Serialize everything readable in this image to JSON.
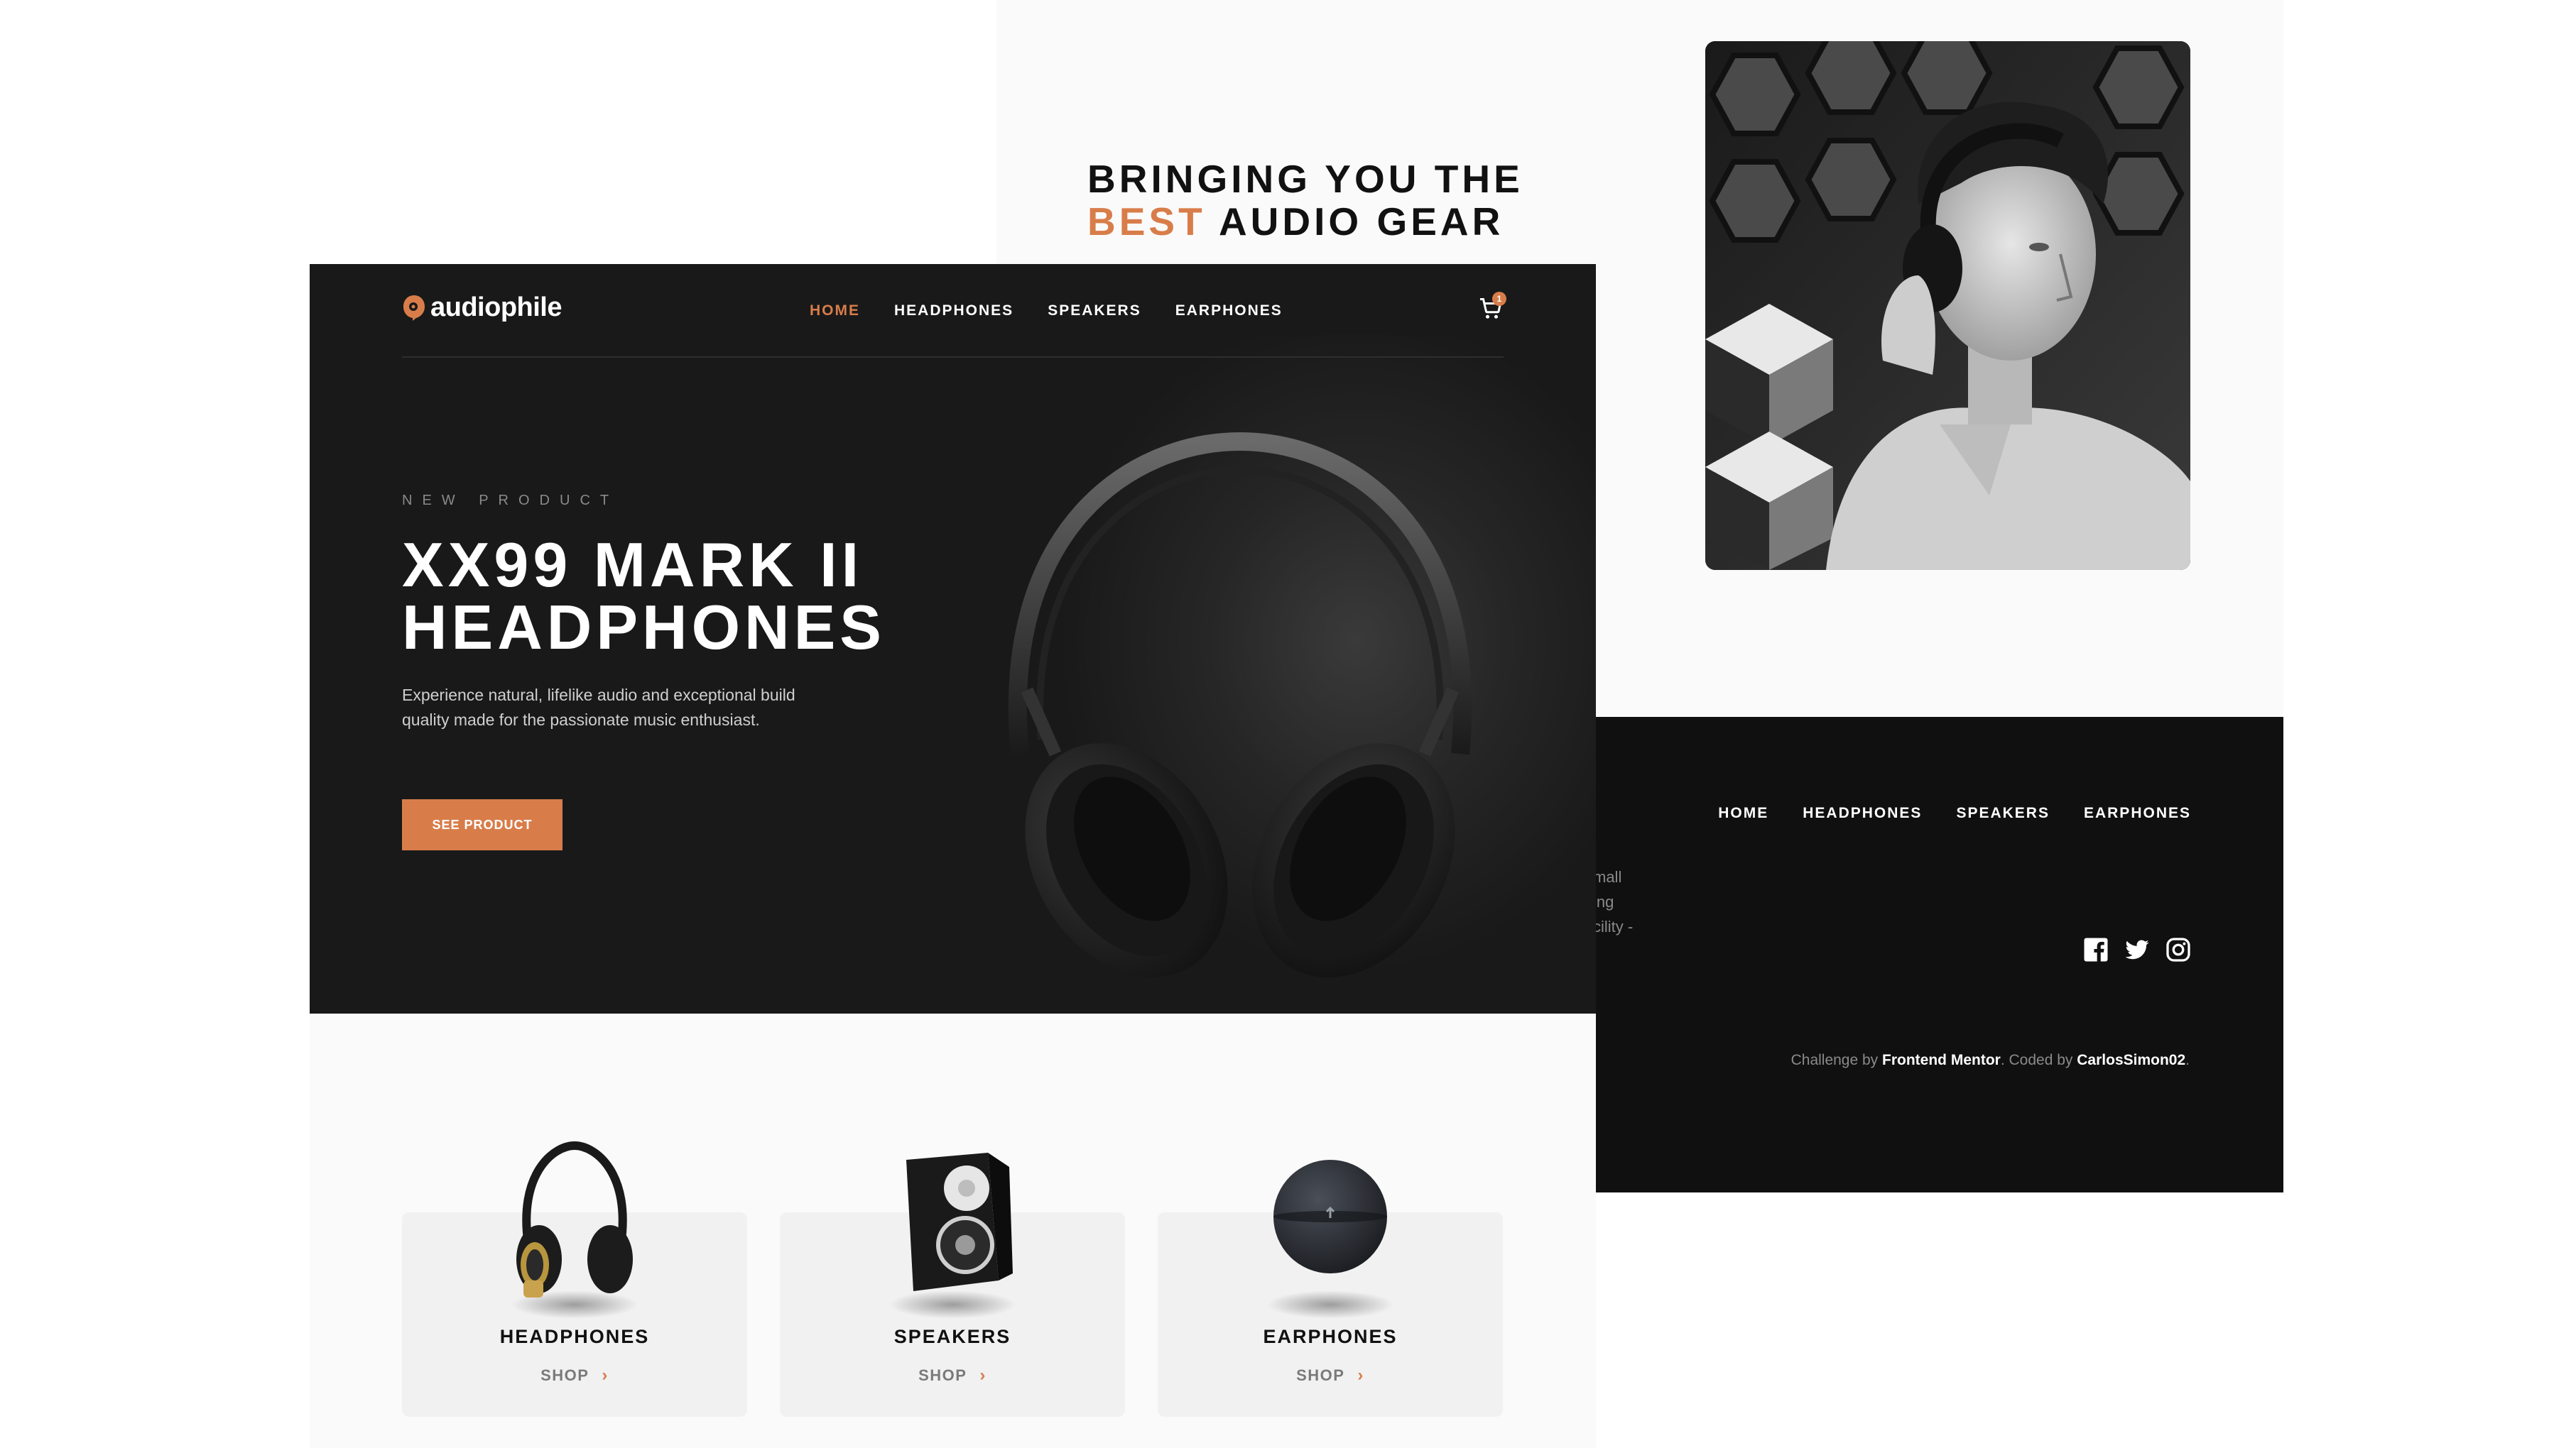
{
  "about": {
    "title_line1": "BRINGING YOU THE",
    "title_accent": "BEST",
    "title_rest": "AUDIO GEAR"
  },
  "footer": {
    "nav": [
      "HOME",
      "HEADPHONES",
      "SPEAKERS",
      "EARPHONES"
    ],
    "clipped_text": [
      "mall",
      "ing",
      "cility -"
    ],
    "credit_prefix": "Challenge by",
    "credit_org": "Frontend Mentor",
    "credit_mid": ". Coded by",
    "credit_author": "CarlosSimon02",
    "credit_suffix": ".",
    "social": [
      "facebook-icon",
      "twitter-icon",
      "instagram-icon"
    ]
  },
  "header": {
    "logo": "audiophile",
    "nav": [
      {
        "label": "HOME",
        "active": true
      },
      {
        "label": "HEADPHONES",
        "active": false
      },
      {
        "label": "SPEAKERS",
        "active": false
      },
      {
        "label": "EARPHONES",
        "active": false
      }
    ],
    "cart_count": "1"
  },
  "hero": {
    "overline": "NEW PRODUCT",
    "title_line1": "XX99 MARK II",
    "title_line2": "HEADPHONES",
    "description": "Experience natural, lifelike audio and exceptional build quality made for the passionate music enthusiast.",
    "cta": "SEE PRODUCT"
  },
  "categories": [
    {
      "name": "HEADPHONES",
      "shop": "SHOP"
    },
    {
      "name": "SPEAKERS",
      "shop": "SHOP"
    },
    {
      "name": "EARPHONES",
      "shop": "SHOP"
    }
  ],
  "colors": {
    "accent": "#d87d4a",
    "dark": "#191919",
    "footer": "#101010",
    "light": "#fafafa",
    "card": "#f1f1f1"
  }
}
